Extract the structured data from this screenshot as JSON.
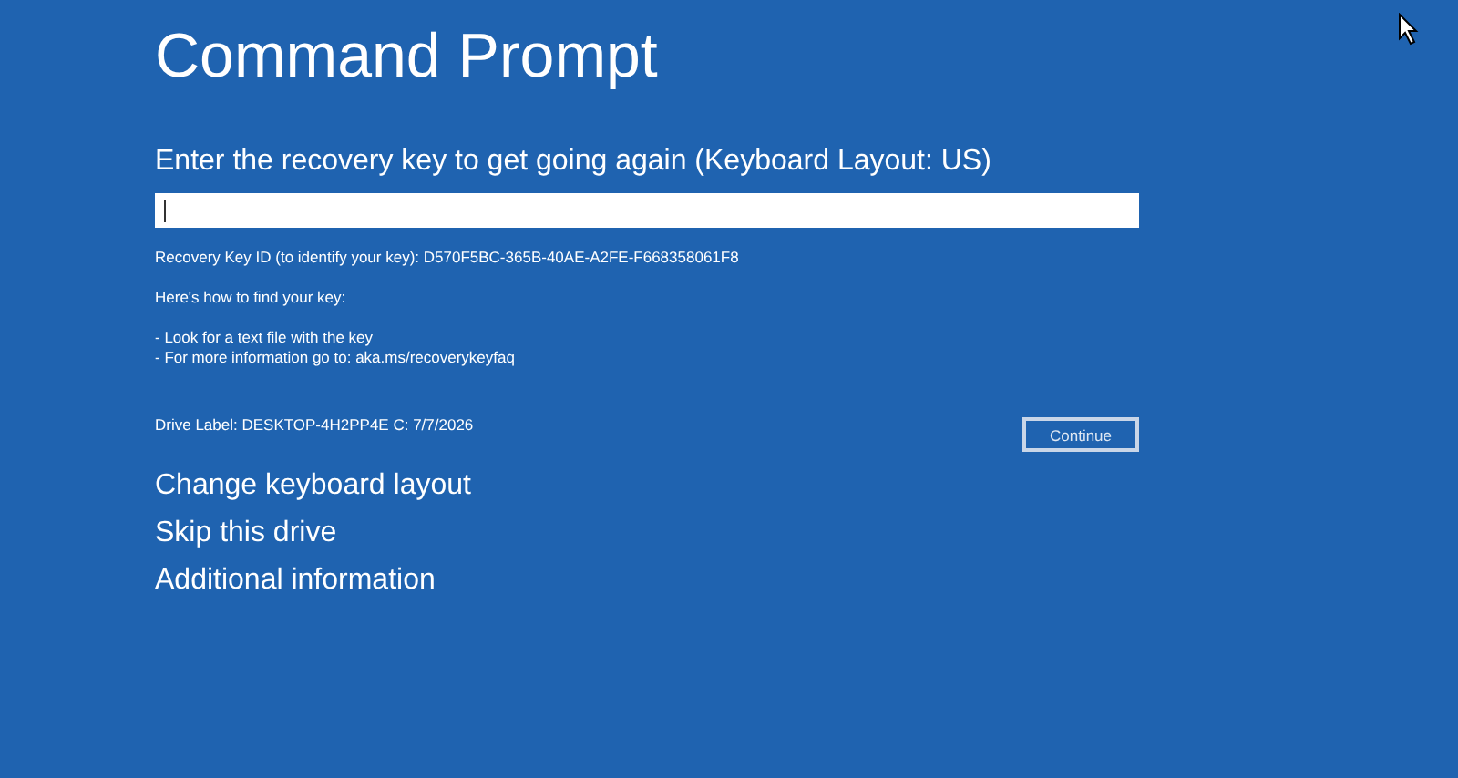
{
  "title": "Command Prompt",
  "prompt": "Enter the recovery key to get going again (Keyboard Layout: US)",
  "key_id": "Recovery Key ID (to identify your key): D570F5BC-365B-40AE-A2FE-F668358061F8",
  "help_heading": "Here's how to find your key:",
  "help_items": [
    "- Look for a text file with the key",
    "- For more information go to: aka.ms/recoverykeyfaq"
  ],
  "drive_label": "Drive Label: DESKTOP-4H2PP4E C: 7/7/2026",
  "continue_button": {
    "label": "Continue"
  },
  "links": [
    "Change keyboard layout",
    "Skip this drive",
    "Additional information"
  ]
}
